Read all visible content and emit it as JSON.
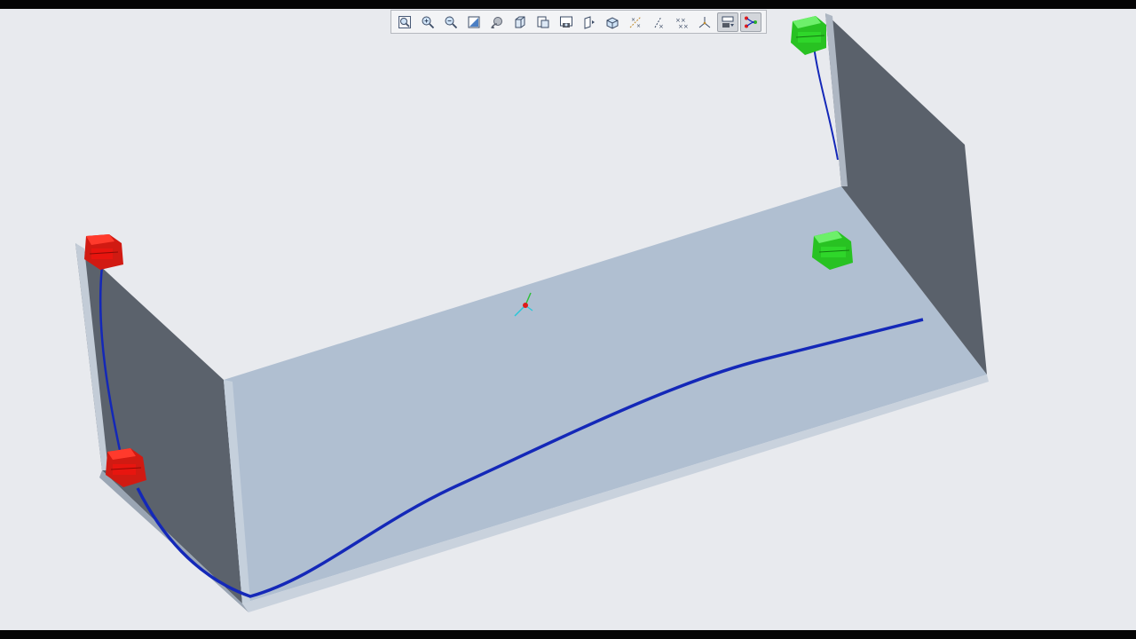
{
  "window": {
    "title": ""
  },
  "toolbar": {
    "buttons": [
      {
        "icon": "refit-icon",
        "active": false
      },
      {
        "icon": "zoom-in-icon",
        "active": false
      },
      {
        "icon": "zoom-out-icon",
        "active": false
      },
      {
        "icon": "repaint-icon",
        "active": false
      },
      {
        "icon": "orient-mode-icon",
        "active": false
      },
      {
        "icon": "saved-orientations-icon",
        "active": false
      },
      {
        "icon": "view-manager-icon",
        "active": false
      },
      {
        "icon": "perspective-icon",
        "active": false
      },
      {
        "icon": "display-style-icon",
        "active": false
      },
      {
        "icon": "named-views-icon",
        "active": false
      },
      {
        "icon": "datum-points-icon",
        "active": false
      },
      {
        "icon": "datum-axes-icon",
        "active": false
      },
      {
        "icon": "point-tags-icon",
        "active": false
      },
      {
        "icon": "csys-display-icon",
        "active": false
      },
      {
        "icon": "annotation-display-icon",
        "active": true
      },
      {
        "icon": "harness-display-icon",
        "active": true
      }
    ]
  },
  "scene": {
    "colors": {
      "background": "#e8eaee",
      "panel_face": "#b0bfd1",
      "wall_dark": "#5a616b",
      "edge_light": "#c9d3de",
      "wire": "#1428b8",
      "connector_start": "#e8150f",
      "connector_end": "#2fd62a"
    },
    "connectors": [
      {
        "name": "connector-red-top",
        "color": "red"
      },
      {
        "name": "connector-red-bottom",
        "color": "red"
      },
      {
        "name": "connector-green-top",
        "color": "green"
      },
      {
        "name": "connector-green-middle",
        "color": "green"
      }
    ]
  }
}
